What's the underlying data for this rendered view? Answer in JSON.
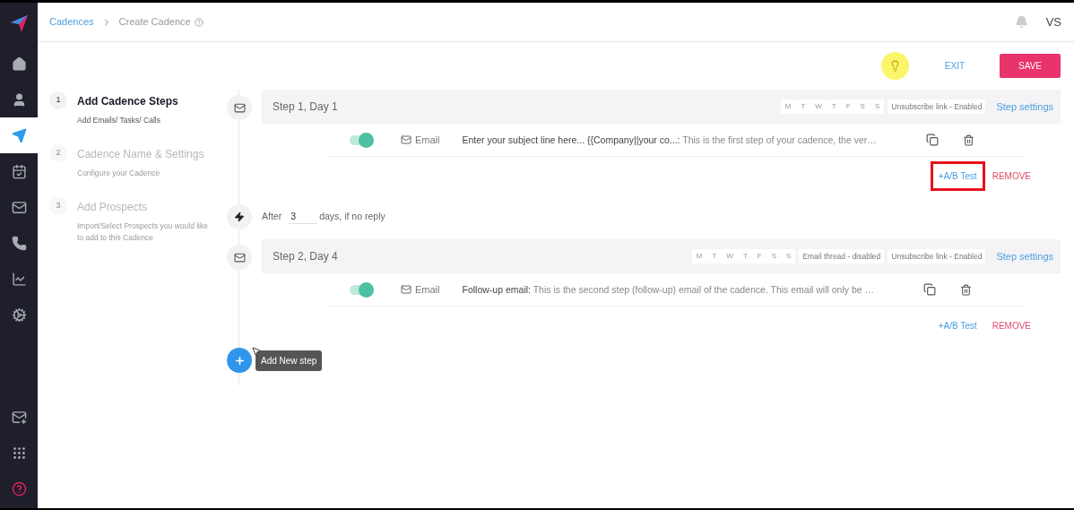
{
  "sidebar": {
    "items": [
      {
        "selected": false
      },
      {
        "selected": false
      },
      {
        "selected": true
      },
      {
        "selected": false
      },
      {
        "selected": false
      },
      {
        "selected": false
      },
      {
        "selected": false
      },
      {
        "selected": false
      }
    ]
  },
  "breadcrumb": {
    "items": [
      "Cadences",
      "Create Cadence"
    ]
  },
  "user": {
    "initials": "VS"
  },
  "actions": {
    "exit": "EXIT",
    "save": "SAVE"
  },
  "wizard": [
    {
      "number": "1",
      "title": "Add Cadence Steps",
      "subtitle": "Add Emails/ Tasks/ Calls",
      "selected": true
    },
    {
      "number": "2",
      "title": "Cadence Name & Settings",
      "subtitle": "Configure your Cadence",
      "selected": false
    },
    {
      "number": "3",
      "title": "Add Prospects",
      "subtitle": "Import/Select Prospects you would like to add to this Cadence",
      "selected": false
    }
  ],
  "timeline": [
    {
      "kind": "step",
      "title": "Step 1, Day 1",
      "days": [
        "M",
        "T",
        "W",
        "T",
        "F",
        "S",
        "S"
      ],
      "flags": [
        "Unsubscribe link - Enabled"
      ],
      "settings": "Step settings",
      "email": {
        "on": true,
        "type": "Email",
        "subject": "Enter your subject line here... {{Company||your co...:",
        "body": "This is the first step of your cadence, the ver…"
      },
      "ab_test": "+A/B Test",
      "ab_highlighted": true,
      "remove": "REMOVE"
    },
    {
      "kind": "wait",
      "before": "After",
      "value": "3",
      "after": "days, if no reply"
    },
    {
      "kind": "step",
      "title": "Step 2, Day 4",
      "days": [
        "M",
        "T",
        "W",
        "T",
        "F",
        "S",
        "S"
      ],
      "flags": [
        "Email thread - disabled",
        "Unsubscribe link - Enabled"
      ],
      "settings": "Step settings",
      "email": {
        "on": true,
        "type": "Email",
        "subject": "Follow-up email:",
        "body": "This is the second step (follow-up) email of the cadence. This email will only be …"
      },
      "ab_test": "+A/B Test",
      "ab_highlighted": false,
      "remove": "REMOVE"
    }
  ],
  "add_step": {
    "tooltip": "Add New step"
  }
}
